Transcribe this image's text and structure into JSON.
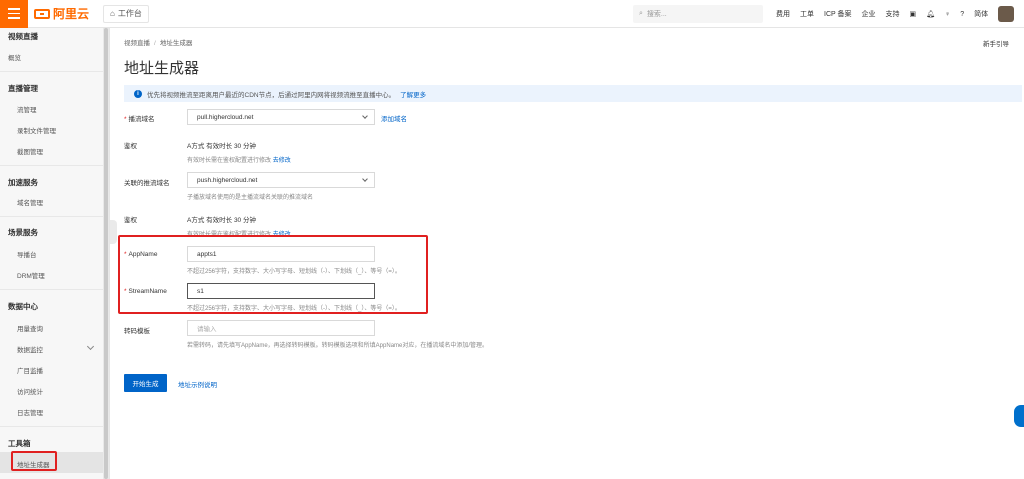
{
  "topbar": {
    "logo_text": "阿里云",
    "workbench": "工作台",
    "search_placeholder": "搜索...",
    "nav": [
      "费用",
      "工单",
      "ICP 备案",
      "企业",
      "支持"
    ],
    "language": "简体"
  },
  "sidebar": {
    "top_title": "视频直播",
    "overview": "概览",
    "groups": [
      {
        "title": "直播管理",
        "items": [
          "流管理",
          "录制文件管理",
          "截图管理"
        ]
      },
      {
        "title": "加速服务",
        "items": [
          "域名管理"
        ]
      },
      {
        "title": "场景服务",
        "items": [
          "导播台",
          "DRM管理"
        ]
      },
      {
        "title": "数据中心",
        "items": [
          "用量查询",
          "数据监控",
          "广目监播",
          "访问统计",
          "日志管理"
        ]
      },
      {
        "title": "工具箱",
        "items": [
          "地址生成器"
        ]
      }
    ]
  },
  "main": {
    "breadcrumb": [
      "视频直播",
      "地址生成器"
    ],
    "help": "新手引导",
    "title": "地址生成器",
    "info_text": "优先将视频推流至距离用户最近的CDN节点，后通过阿里内网将视频流推至直播中心。",
    "info_link": "了解更多",
    "form": {
      "play_domain_label": "播流域名",
      "play_domain_value": "pull.highercloud.net",
      "add_domain": "添加域名",
      "auth1_label": "鉴权",
      "auth1_value": "A方式 有效时长 30 分钟",
      "auth1_hint": "有效时长需在鉴权配置进行修改",
      "auth1_hint_link": "去修改",
      "push_domain_label": "关联的推流域名",
      "push_domain_value": "push.highercloud.net",
      "push_domain_hint": "子播放域名使用的是主播流域名关联的推流域名",
      "auth2_label": "鉴权",
      "auth2_value": "A方式 有效时长 30 分钟",
      "auth2_hint": "有效时长需在鉴权配置进行修改",
      "auth2_hint_link": "去修改",
      "appname_label": "AppName",
      "appname_value": "appts1",
      "appname_hint": "不超过256字符，支持数字、大小写字母、短划线（-）、下划线（_）、等号（=）。",
      "stream_label": "StreamName",
      "stream_value": "s1",
      "stream_hint": "不超过256字符，支持数字、大小写字母、短划线（-）、下划线（_）、等号（=）。",
      "transcode_label": "转码模板",
      "transcode_placeholder": "请输入",
      "transcode_hint": "若需转码，请先填写AppName，再选择转码模板。转码模板选项和所填AppName对应，在播流域名中添加/管理。"
    },
    "submit": "开始生成",
    "example_link": "地址示例说明"
  }
}
